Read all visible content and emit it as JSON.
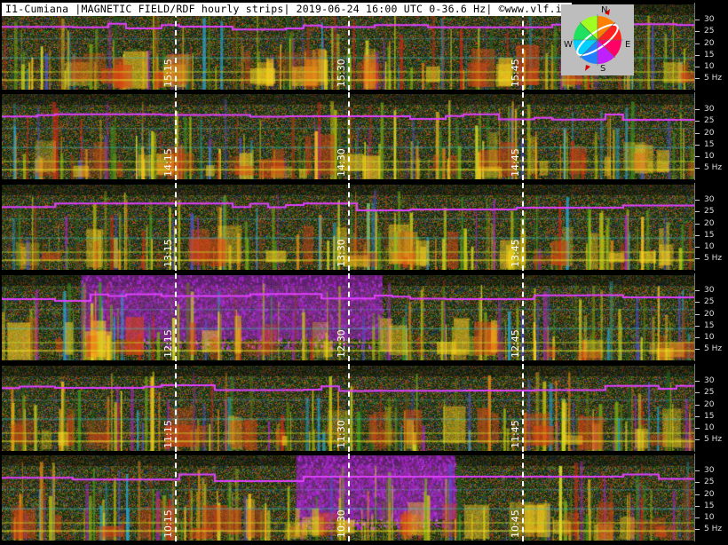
{
  "title": "I1-Cumiana |MAGNETIC FIELD/RDF hourly strips| 2019-06-24 16:00 UTC 0-36.6 Hz| ©www.vlf.it",
  "compass": {
    "n": "N",
    "s": "S",
    "e": "E",
    "w": "W"
  },
  "scale_labels": [
    "30",
    "25",
    "20",
    "15",
    "10",
    "5 Hz"
  ],
  "scale_values": [
    30,
    25,
    20,
    15,
    10,
    5
  ],
  "freq_max": 36.6,
  "strips": [
    {
      "labels": [
        "15:15",
        "15:30",
        "15:45"
      ],
      "magenta_blocks": []
    },
    {
      "labels": [
        "14:15",
        "14:30",
        "14:45"
      ],
      "magenta_blocks": []
    },
    {
      "labels": [
        "13:15",
        "13:30",
        "13:45"
      ],
      "magenta_blocks": []
    },
    {
      "labels": [
        "12:15",
        "12:30",
        "12:45"
      ],
      "magenta_blocks": [
        [
          0.115,
          0.55
        ]
      ]
    },
    {
      "labels": [
        "11:15",
        "11:30",
        "11:45"
      ],
      "magenta_blocks": []
    },
    {
      "labels": [
        "10:15",
        "10:30",
        "10:45"
      ],
      "magenta_blocks": [
        [
          0.425,
          0.655
        ]
      ]
    }
  ],
  "colors": {
    "background": "#000000",
    "marker": "#ffffff",
    "band": "#e040ff"
  }
}
